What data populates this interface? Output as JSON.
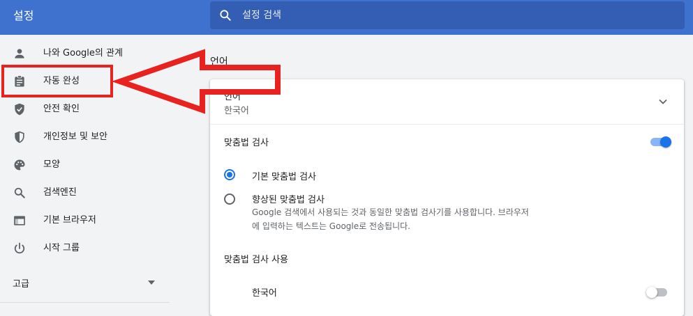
{
  "header": {
    "title": "설정",
    "search_placeholder": "설정 검색",
    "bar_color": "#3f72cf"
  },
  "sidebar": {
    "items": [
      {
        "label": "나와 Google의 관계",
        "icon": "person-icon"
      },
      {
        "label": "자동 완성",
        "icon": "clipboard-icon"
      },
      {
        "label": "안전 확인",
        "icon": "shield-check-icon"
      },
      {
        "label": "개인정보 및 보안",
        "icon": "shield-half-icon"
      },
      {
        "label": "모양",
        "icon": "palette-icon"
      },
      {
        "label": "검색엔진",
        "icon": "search-icon"
      },
      {
        "label": "기본 브라우저",
        "icon": "browser-window-icon"
      },
      {
        "label": "시작 그룹",
        "icon": "power-icon"
      }
    ],
    "advanced_label": "고급"
  },
  "main": {
    "section_title": "언어",
    "language_row": {
      "label": "언어",
      "value": "한국어"
    },
    "spellcheck": {
      "title": "맞춤법 검사",
      "enabled": true,
      "options": [
        {
          "label": "기본 맞춤법 검사",
          "checked": true
        },
        {
          "label": "향상된 맞춤법 검사",
          "checked": false,
          "description_line1": "Google 검색에서 사용되는 것과 동일한 맞춤법 검사기를 사용합니다. 브라우저",
          "description_line2": "에 입력하는 텍스트는 Google로 전송됩니다."
        }
      ],
      "use_title": "맞춤법 검사 사용",
      "languages": [
        {
          "label": "한국어",
          "enabled": false
        }
      ]
    }
  },
  "annotation": {
    "color": "#e8231f",
    "highlighted_item": "자동 완성"
  },
  "colors": {
    "accent": "#1a73e8",
    "icon": "#5f6368"
  }
}
